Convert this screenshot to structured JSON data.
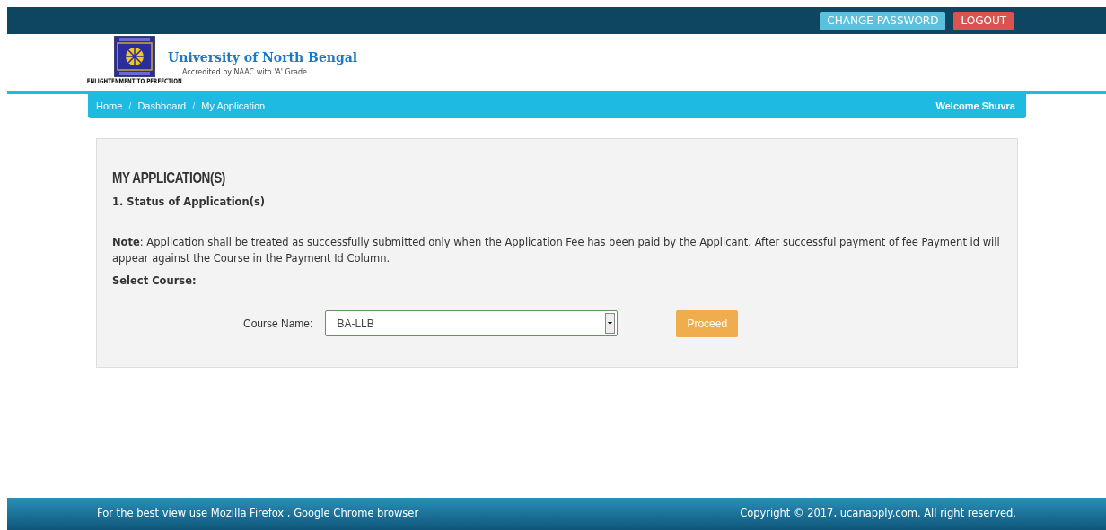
{
  "top_bar": {
    "buttons": [
      {
        "label": "CHANGE PASSWORD",
        "kind": "info"
      },
      {
        "label": "LOGOUT",
        "kind": "danger"
      }
    ]
  },
  "header": {
    "title": "University of North Bengal",
    "subtitle": "Accredited by NAAC with 'A' Grade",
    "motto": "ENLIGHTENMENT TO PERFECTION"
  },
  "breadcrumb": {
    "items": [
      {
        "label": "Home",
        "kind": "link"
      },
      {
        "label": "/",
        "kind": "separator"
      },
      {
        "label": "Dashboard",
        "kind": "link"
      },
      {
        "label": "/",
        "kind": "separator"
      },
      {
        "label": "My Application",
        "kind": "link"
      }
    ],
    "welcome": "Welcome Shuvra"
  },
  "panel": {
    "title": "MY APPLICATION(S)",
    "section": "1. Status of Application(s)",
    "note": "**Note**: Application shall be treated as successfully submitted only when the Application Fee has been paid by the Applicant. After successful payment of fee Payment id will appear against the Course in the Payment Id Column.",
    "select_heading": "Select Course:",
    "course_label": "Course Name:",
    "course_value": "BA-LLB",
    "button": "Proceed"
  },
  "footer": {
    "left": "For the best view use Mozilla Firefox , Google Chrome browser",
    "right": "Copyright © 2017, ucanapply.com. All right reserved."
  }
}
